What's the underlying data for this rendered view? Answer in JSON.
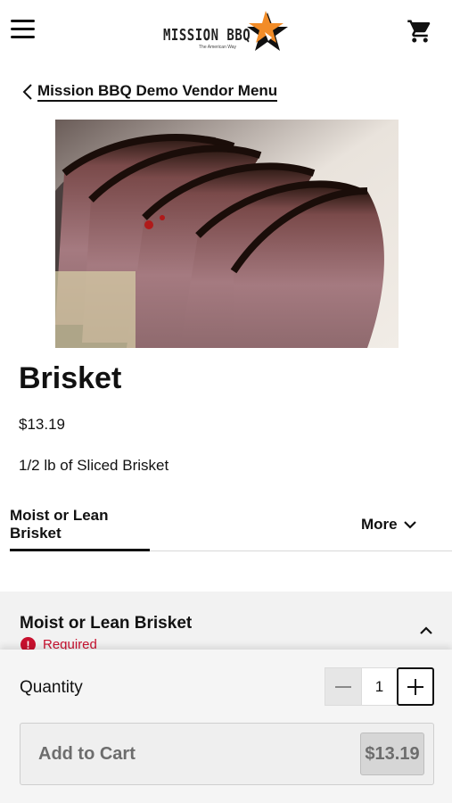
{
  "header": {
    "logo_text": "MISSION BBQ",
    "logo_tagline": "The American Way",
    "menu_icon": "hamburger-menu-icon",
    "cart_icon": "shopping-cart-icon"
  },
  "breadcrumb": {
    "back_label": "Mission BBQ Demo Vendor Menu",
    "back_icon": "chevron-left-icon"
  },
  "product": {
    "image": "brisket-photo",
    "title": "Brisket",
    "price": "$13.19",
    "description": "1/2 lb of Sliced Brisket"
  },
  "tabs": {
    "active_label": "Moist or Lean Brisket",
    "more_label": "More"
  },
  "option_section": {
    "title": "Moist or Lean Brisket",
    "required_label": "Required",
    "required_icon": "!"
  },
  "order": {
    "quantity_label": "Quantity",
    "quantity_value": "1",
    "add_to_cart_label": "Add to Cart",
    "total_price": "$13.19"
  },
  "colors": {
    "required": "#c8102e",
    "logo_star": "#f28c28",
    "text": "#111111",
    "disabled_text": "#6d6d6d"
  }
}
